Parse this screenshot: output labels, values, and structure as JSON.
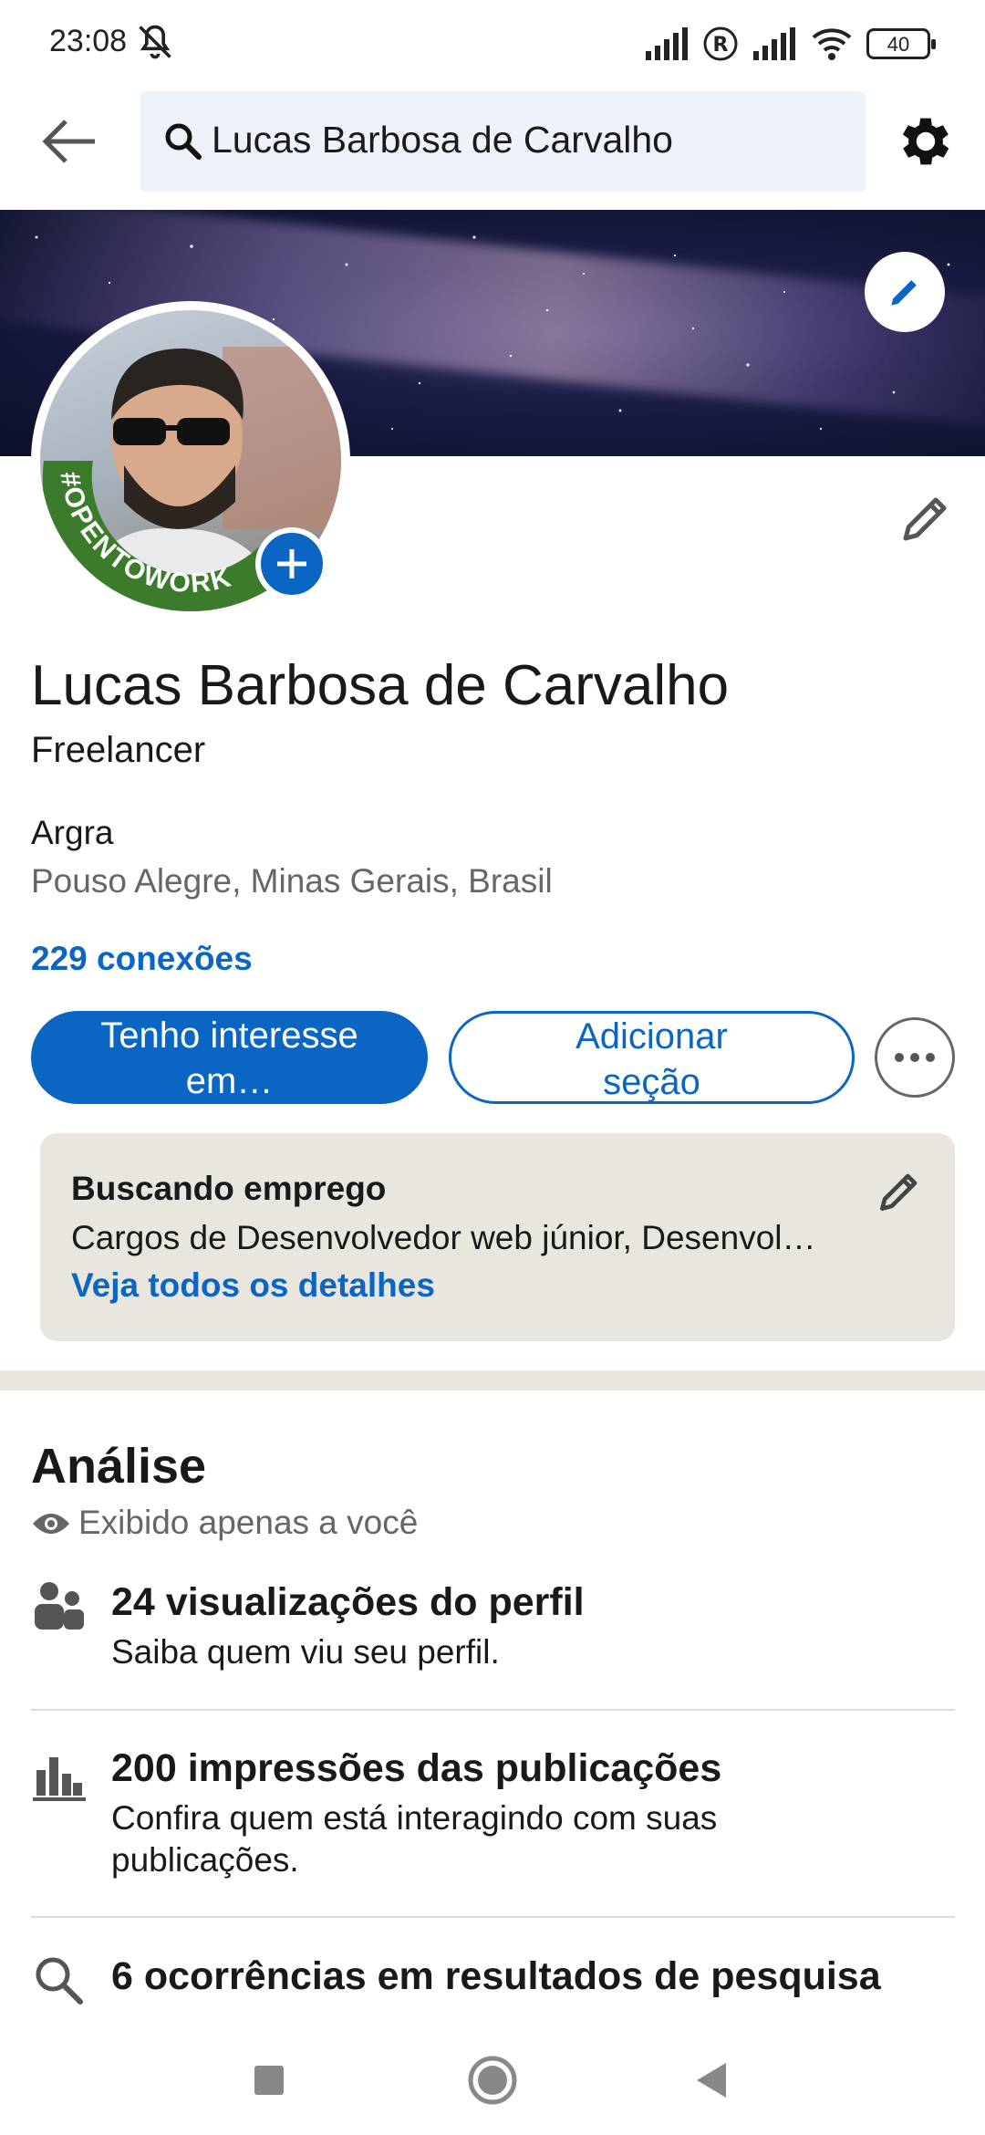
{
  "status_bar": {
    "time": "23:08",
    "battery": "40",
    "icons": [
      "mute-bell-icon",
      "signal-icon",
      "roaming-icon",
      "signal-icon",
      "wifi-icon",
      "battery-icon"
    ]
  },
  "top_bar": {
    "search_value": "Lucas Barbosa de Carvalho"
  },
  "profile": {
    "name": "Lucas Barbosa de Carvalho",
    "headline": "Freelancer",
    "company": "Argra",
    "location": "Pouso Alegre, Minas Gerais, Brasil",
    "connections": "229 conexões",
    "open_to_work_frame": "#OPENTOWORK"
  },
  "actions": {
    "primary": "Tenho interesse em…",
    "secondary": "Adicionar seção"
  },
  "open_to_work_card": {
    "title": "Buscando emprego",
    "description": "Cargos de Desenvolvedor web júnior, Desenvol…",
    "link": "Veja todos os detalhes"
  },
  "analytics": {
    "title": "Análise",
    "subtitle": "Exibido apenas a você",
    "items": [
      {
        "icon": "people-icon",
        "title": "24 visualizações do perfil",
        "desc": "Saiba quem viu seu perfil."
      },
      {
        "icon": "bar-chart-icon",
        "title": "200 impressões das publicações",
        "desc": "Confira quem está interagindo com suas publicações."
      },
      {
        "icon": "search-icon",
        "title": "6 ocorrências em resultados de pesquisa",
        "desc": ""
      }
    ]
  },
  "colors": {
    "accent": "#0a66c2",
    "card_bg": "#e9e5df",
    "muted_text": "#666666",
    "open_to_work_green": "#3d7b2c"
  }
}
